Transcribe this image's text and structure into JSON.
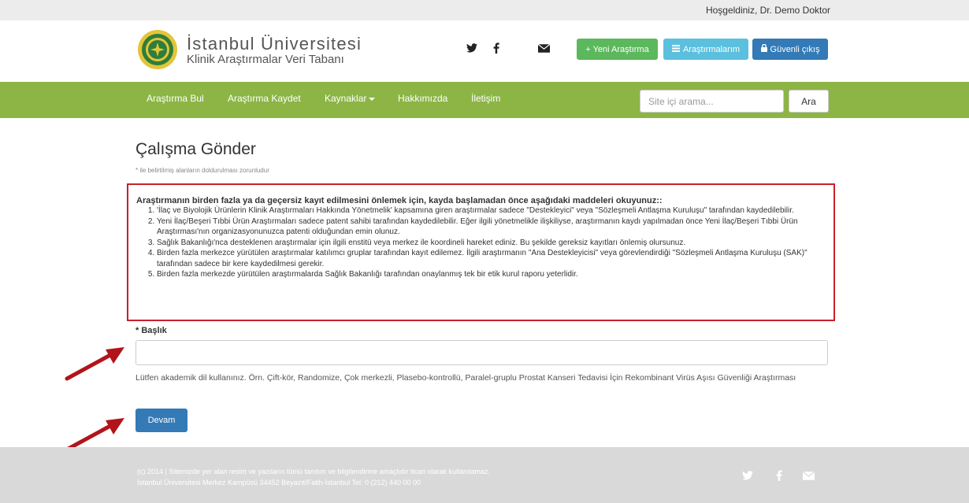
{
  "topbar": {
    "welcome": "Hoşgeldiniz, Dr. Demo Doktor"
  },
  "brand": {
    "title": "İstanbul Üniversitesi",
    "subtitle": "Klinik Araştırmalar Veri Tabanı",
    "logo_icon": "university-seal"
  },
  "social": {
    "twitter_icon": "twitter-icon",
    "facebook_icon": "facebook-icon",
    "mail_icon": "envelope-icon"
  },
  "header_buttons": {
    "new_research": "+ Yeni Araştırma",
    "my_research": "Araştırmalarım",
    "logout": "Güvenli çıkış"
  },
  "nav": {
    "items": [
      "Araştırma Bul",
      "Araştırma Kaydet",
      "Kaynaklar",
      "Hakkımızda",
      "İletişim"
    ],
    "search_placeholder": "Site içi arama...",
    "search_button": "Ara"
  },
  "form": {
    "page_title": "Çalışma Gönder",
    "required_note": "* ile belirtilmiş alanların doldurulması zorunludur",
    "notice_title": "Araştırmanın birden fazla ya da geçersiz kayıt edilmesini önlemek için, kayda başlamadan önce aşağıdaki maddeleri okuyunuz::",
    "notice_items": [
      "'İlaç ve Biyolojik Ürünlerin Klinik Araştırmaları Hakkında Yönetmelik' kapsamına giren araştırmalar sadece \"Destekleyici\" veya \"Sözleşmeli Antlaşma Kuruluşu\" tarafından kaydedilebilir.",
      "Yeni İlaç/Beşeri Tıbbi Ürün Araştırmaları sadece patent sahibi tarafından kaydedilebilir. Eğer ilgili yönetmelikle ilişkiliyse, araştırmanın kaydı yapılmadan önce Yeni İlaç/Beşeri Tıbbi Ürün Araştırması'nın organizasyonunuzca patenti olduğundan emin olunuz.",
      "Sağlık Bakanlığı'nca desteklenen araştırmalar için ilgili enstitü veya merkez ile koordineli hareket ediniz. Bu şekilde gereksiz kayıtları önlemiş olursunuz.",
      "Birden fazla merkezce yürütülen araştırmalar katılımcı gruplar tarafından kayıt edilemez. İlgili araştırmanın \"Ana Destekleyicisi\" veya görevlendirdiği \"Sözleşmeli Antlaşma Kuruluşu (SAK)\" tarafından sadece bir kere kaydedilmesi gerekir.",
      "Birden fazla merkezde yürütülen araştırmalarda Sağlık Bakanlığı tarafından onaylanmış tek bir etik kurul raporu yeterlidir."
    ],
    "title_label": "* Başlık",
    "title_value": "",
    "help_text": "Lütfen akademik dil kullanınız. Örn. Çift-kör, Randomize, Çok merkezli, Plasebo-kontrollü, Paralel-gruplu Prostat Kanseri Tedavisi İçin Rekombinant Virüs Aşısı Güvenliği Araştırması",
    "continue_button": "Devam"
  },
  "footer": {
    "line1": "(c) 2014 | Sitemizde yer alan resim ve yazıların tümü tanıtım ve bilgilendirme amaçlıdır ticari olarak kullanılamaz.",
    "line2": "İstanbul Üniversitesi Merkez Kampüsü 34452 Beyazıt/Fatih-İstanbul Tel: 0 (212) 440 00 00"
  },
  "colors": {
    "nav_green": "#8cb546",
    "button_green": "#5cb85c",
    "button_cyan": "#5bc0de",
    "button_blue": "#337ab7",
    "notice_border": "#c9202a",
    "annotation_arrow": "#b2141b"
  }
}
